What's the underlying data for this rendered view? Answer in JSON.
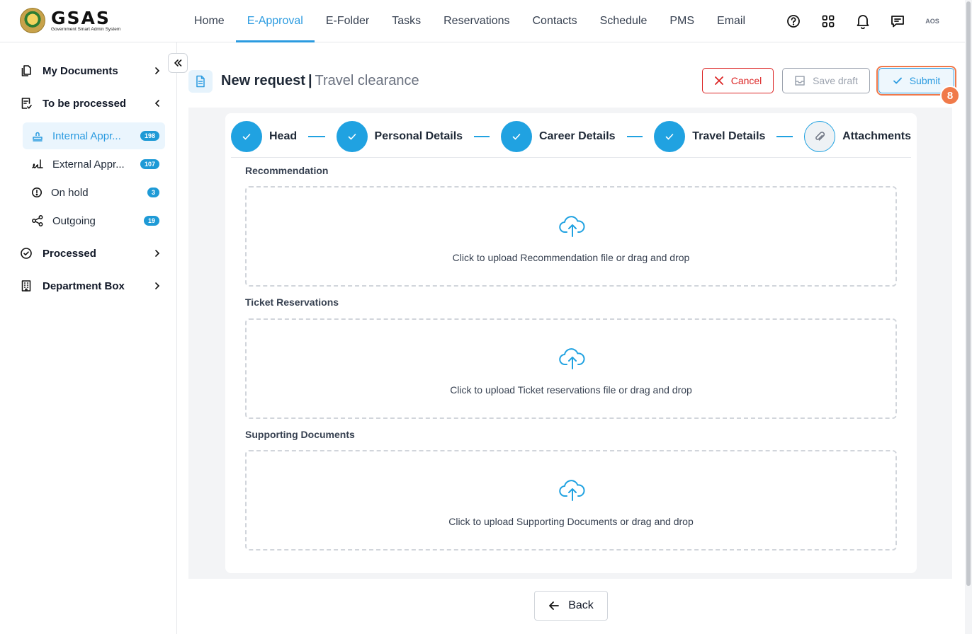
{
  "brand": {
    "title": "GSAS",
    "subtitle": "Government Smart Admin System"
  },
  "nav": {
    "items": [
      "Home",
      "E-Approval",
      "E-Folder",
      "Tasks",
      "Reservations",
      "Contacts",
      "Schedule",
      "PMS",
      "Email"
    ],
    "active": "E-Approval"
  },
  "top_icons": [
    "help-icon",
    "apps-grid-icon",
    "bell-icon",
    "chat-icon"
  ],
  "avatar_text": "AOS",
  "sidebar": {
    "groups": [
      {
        "label": "My Documents",
        "icon": "documents-icon",
        "expanded": false
      },
      {
        "label": "To be processed",
        "icon": "inbox-check-icon",
        "expanded": true
      },
      {
        "label": "Processed",
        "icon": "check-circle-icon",
        "expanded": false
      },
      {
        "label": "Department Box",
        "icon": "building-icon",
        "expanded": false
      }
    ],
    "subitems": [
      {
        "label": "Internal Appr...",
        "count": "198",
        "icon": "stamp-icon",
        "active": true
      },
      {
        "label": "External Appr...",
        "count": "107",
        "icon": "signature-icon",
        "active": false
      },
      {
        "label": "On hold",
        "count": "3",
        "icon": "alert-circle-icon",
        "active": false
      },
      {
        "label": "Outgoing",
        "count": "19",
        "icon": "share-icon",
        "active": false
      }
    ]
  },
  "header": {
    "title": "New request",
    "separator": "|",
    "subtitle": "Travel clearance",
    "cancel_label": "Cancel",
    "draft_label": "Save draft",
    "submit_label": "Submit",
    "step_marker": "8"
  },
  "steps": [
    {
      "label": "Head",
      "status": "done"
    },
    {
      "label": "Personal Details",
      "status": "done"
    },
    {
      "label": "Career Details",
      "status": "done"
    },
    {
      "label": "Travel Details",
      "status": "done"
    },
    {
      "label": "Attachments",
      "status": "current"
    }
  ],
  "attachments": [
    {
      "label": "Recommendation",
      "hint": "Click to upload Recommendation file or drag and drop"
    },
    {
      "label": "Ticket Reservations",
      "hint": "Click to upload Ticket reservations file or drag and drop"
    },
    {
      "label": "Supporting Documents",
      "hint": "Click to upload Supporting Documents or drag and drop"
    }
  ],
  "back_label": "Back",
  "colors": {
    "accent": "#20a2e1",
    "danger": "#dc2626",
    "highlight": "#f07a4a"
  }
}
